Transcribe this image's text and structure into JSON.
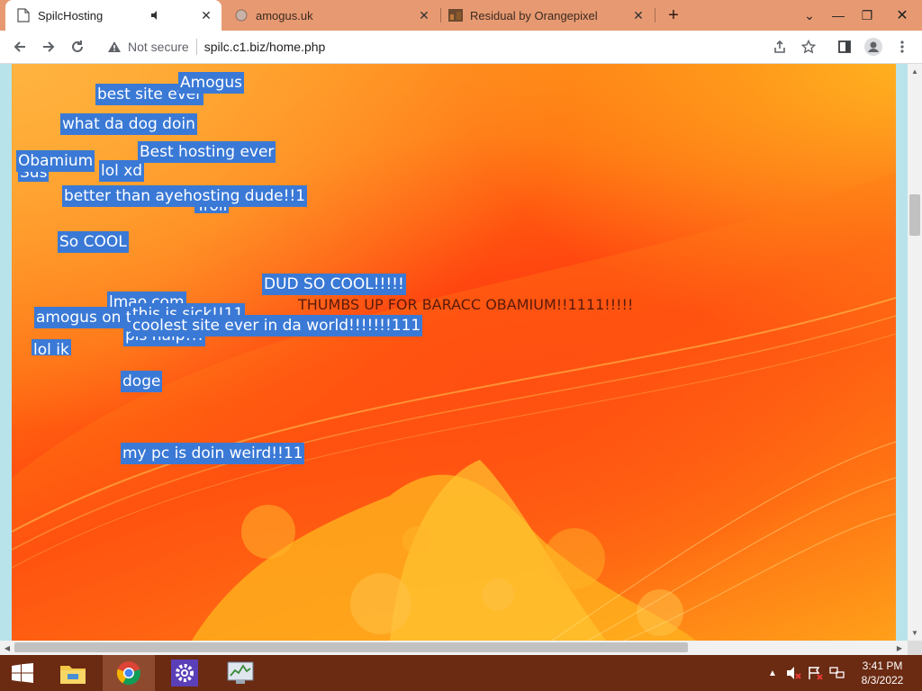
{
  "tabs": [
    {
      "title": "SpilcHosting",
      "favicon": "document-icon",
      "active": true
    },
    {
      "title": "amogus.uk",
      "favicon": "globe-icon",
      "active": false
    },
    {
      "title": "Residual by Orangepixel",
      "favicon": "game-icon",
      "active": false
    }
  ],
  "toolbar": {
    "security_label": "Not secure",
    "url": "spilc.c1.biz/home.php"
  },
  "page": {
    "labels": [
      {
        "text": "best site ever"
      },
      {
        "text": "Amogus"
      },
      {
        "text": "what da dog doin"
      },
      {
        "text": "Best hosting ever"
      },
      {
        "text": "Sus"
      },
      {
        "text": "Obamium"
      },
      {
        "text": "lol xd"
      },
      {
        "text": "Troll"
      },
      {
        "text": "better than ayehosting dude!!1"
      },
      {
        "text": "So COOL"
      },
      {
        "text": "DUD SO COOL!!!!!"
      },
      {
        "text": "lmao.com"
      },
      {
        "text": "amogus on th"
      },
      {
        "text": "this is sick!!11"
      },
      {
        "text": "pls halp!!!"
      },
      {
        "text": "coolest site ever in da world!!!!!!!111"
      },
      {
        "text": "lol ik"
      },
      {
        "text": "doge"
      },
      {
        "text": "my pc is doin weird!!11"
      }
    ],
    "plain_text": "THUMBS UP FOR BARACC OBAMIUM!!1111!!!!!"
  },
  "taskbar": {
    "apps": [
      {
        "name": "file-explorer-icon"
      },
      {
        "name": "chrome-icon"
      },
      {
        "name": "settings-gear-icon"
      },
      {
        "name": "task-manager-icon"
      }
    ],
    "clock": {
      "time": "3:41 PM",
      "date": "8/3/2022"
    }
  },
  "colors": {
    "tabstrip": "#e79a72",
    "label_bg": "#3a79d6",
    "taskbar": "#6b2a12"
  }
}
